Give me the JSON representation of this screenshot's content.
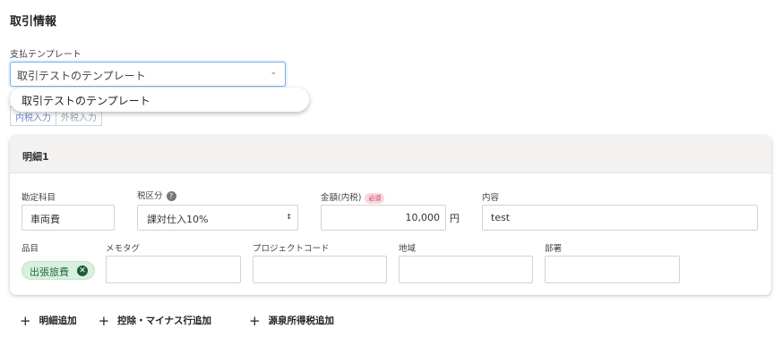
{
  "section": {
    "title": "取引情報"
  },
  "template": {
    "label": "支払テンプレート",
    "selected": "取引テストのテンプレート",
    "dropdown_option": "取引テストのテンプレート"
  },
  "tax_mode": {
    "inclusive": "内税入力",
    "exclusive": "外税入力"
  },
  "line_item": {
    "title": "明細1",
    "labels": {
      "account": "勘定科目",
      "tax": "税区分",
      "amount": "金額(内税)",
      "required": "必須",
      "description": "内容",
      "item": "品目",
      "memo": "メモタグ",
      "project": "プロジェクトコード",
      "region": "地域",
      "department": "部署"
    },
    "values": {
      "account": "車両費",
      "tax": "課対仕入10%",
      "amount": "10,000",
      "currency": "円",
      "description": "test",
      "item_tag": "出張旅費"
    }
  },
  "actions": {
    "add_line": "明細追加",
    "add_deduction": "控除・マイナス行追加",
    "add_withholding": "源泉所得税追加"
  }
}
